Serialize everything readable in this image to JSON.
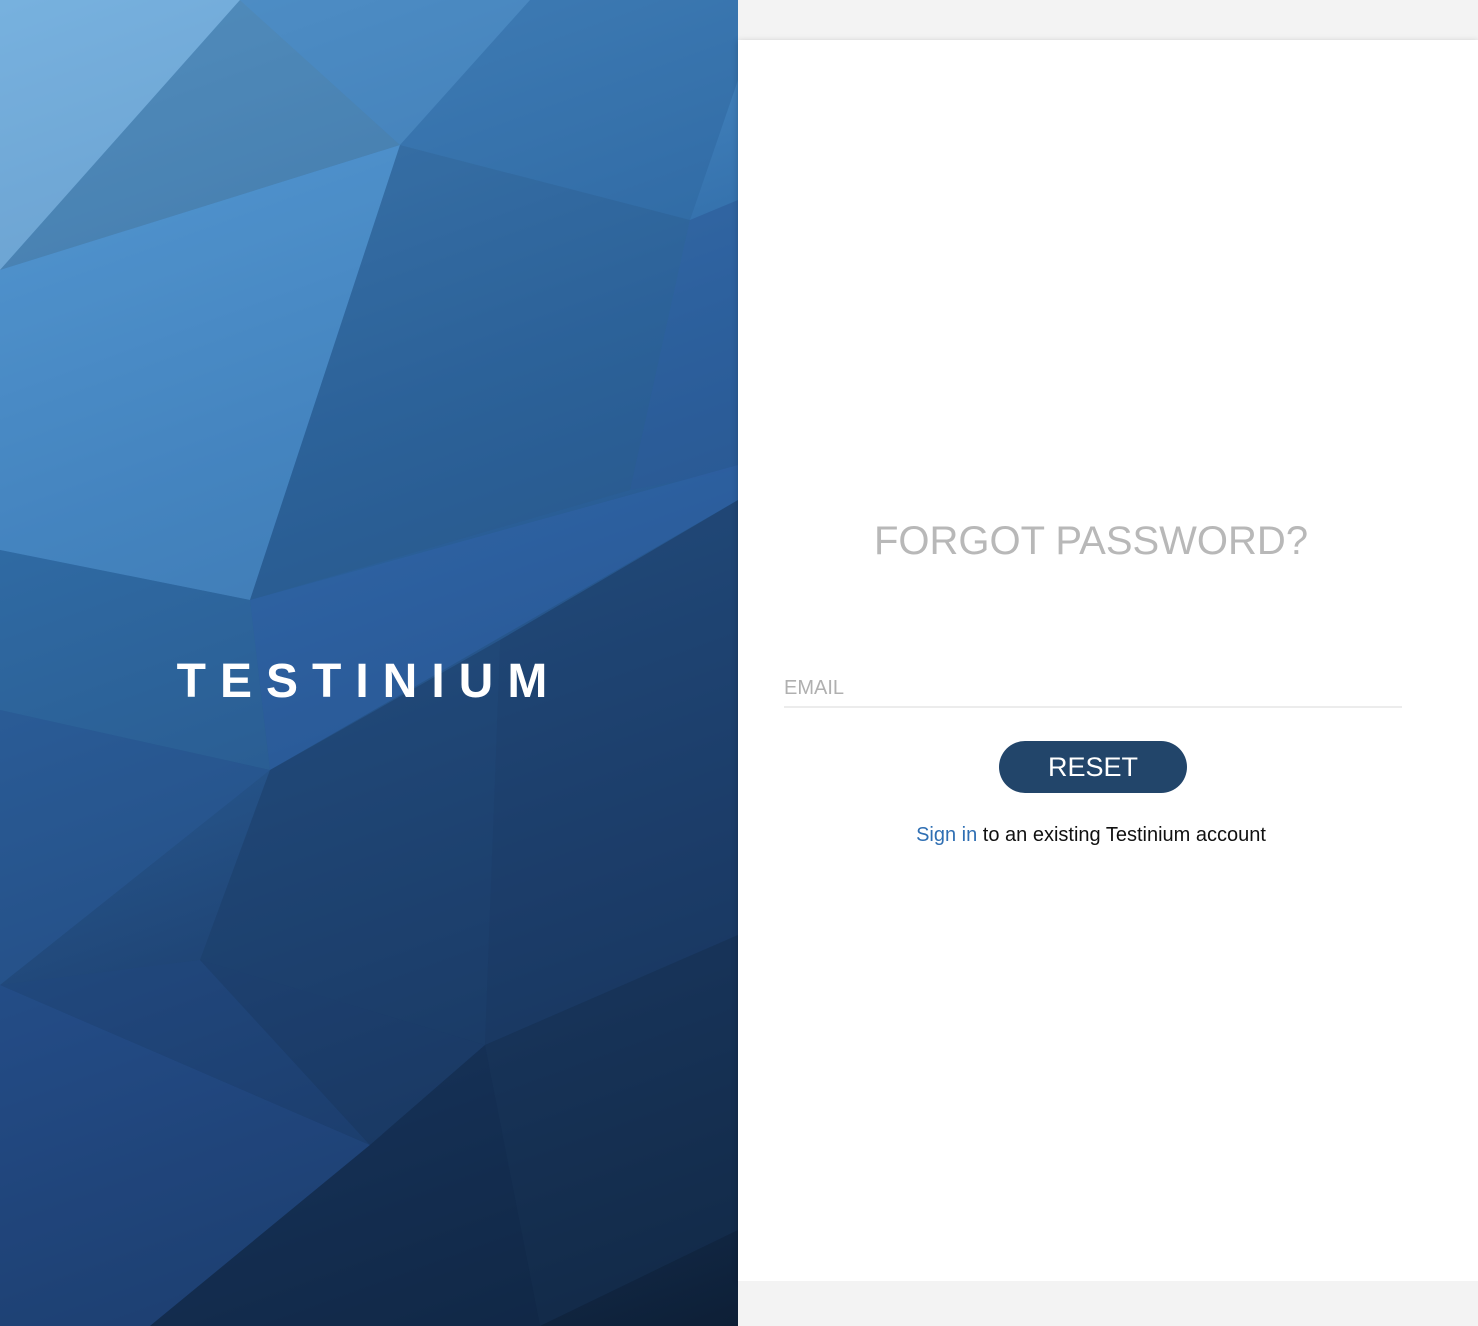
{
  "brand": {
    "logo_text": "TESTINIUM"
  },
  "form": {
    "title": "FORGOT PASSWORD?",
    "email_placeholder": "EMAIL",
    "reset_label": "RESET",
    "signin_link_text": "Sign in",
    "signin_suffix": " to an existing Testinium account"
  },
  "colors": {
    "accent": "#22456a",
    "link": "#2f6fb3",
    "title_gray": "#b8b8b8"
  }
}
